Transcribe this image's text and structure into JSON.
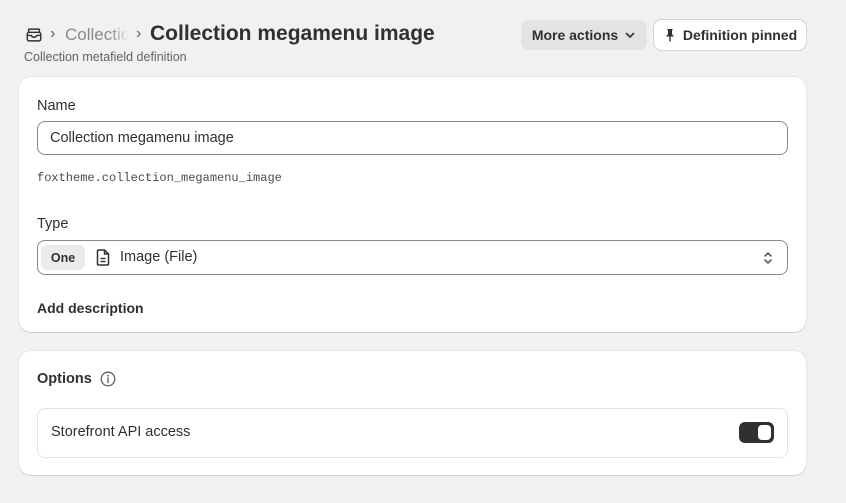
{
  "header": {
    "breadcrumb_icon": "collection-icon",
    "breadcrumb_separator": "›",
    "breadcrumb_parent": "Collections",
    "title": "Collection megamenu image",
    "subtitle": "Collection metafield definition",
    "more_actions_label": "More actions",
    "more_actions_icon": "chevron-down-icon",
    "pin_label": "Definition pinned",
    "pin_icon": "pin-icon"
  },
  "definition": {
    "name_label": "Name",
    "name_value": "Collection megamenu image",
    "namespace_key": "foxtheme.collection_megamenu_image",
    "type_label": "Type",
    "type_badge": "One",
    "type_icon": "file-icon",
    "type_value": "Image (File)",
    "add_description_label": "Add description"
  },
  "options": {
    "title": "Options",
    "info_icon": "info-icon",
    "storefront_label": "Storefront API access",
    "storefront_enabled": true
  },
  "colors": {
    "background": "#f1f1f1",
    "card": "#ffffff",
    "text": "#303030",
    "toggle_on": "#303030"
  }
}
